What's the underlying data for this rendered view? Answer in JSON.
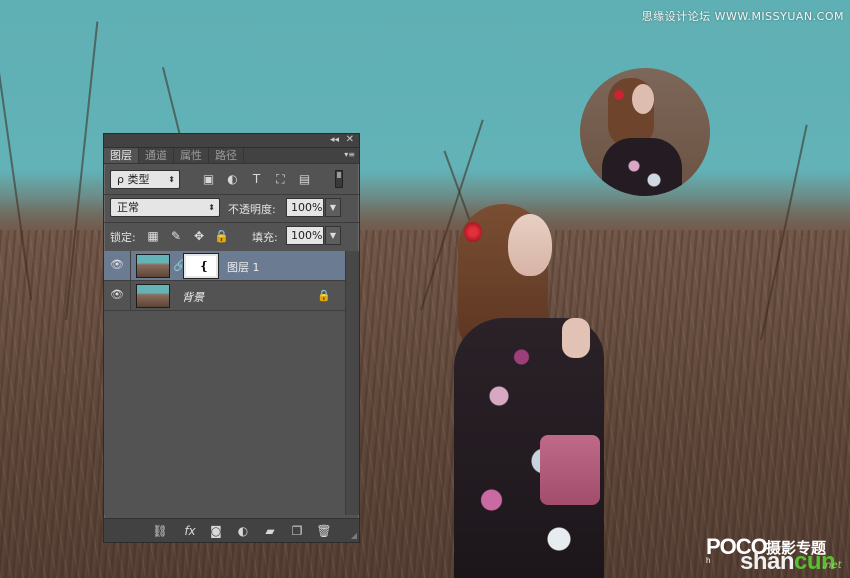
{
  "watermark": {
    "top_right": "思缘设计论坛 WWW.MISSYUAN.COM",
    "poco": "POCO",
    "poco_sub": "h",
    "topic": "摄影专题",
    "shancun_a": "shan",
    "shancun_b": "cun",
    "net": ".net"
  },
  "panel": {
    "collapse_label": "◂◂",
    "close_label": "✕",
    "tabs": [
      {
        "label": "图层",
        "active": true
      },
      {
        "label": "通道",
        "active": false
      },
      {
        "label": "属性",
        "active": false
      },
      {
        "label": "路径",
        "active": false
      }
    ],
    "menu_label": "▾≡",
    "filter": {
      "kind_label": "ρ 类型",
      "icons": [
        "image-filter-icon",
        "adjustment-filter-icon",
        "type-filter-icon",
        "shape-filter-icon",
        "smart-object-filter-icon"
      ],
      "icon_glyphs": [
        "▣",
        "◐",
        "T",
        "⛶",
        "▤"
      ]
    },
    "blend_mode": "正常",
    "opacity_label": "不透明度:",
    "opacity_value": "100%",
    "lock_label": "锁定:",
    "lock_glyphs": [
      "▦",
      "✎",
      "✥",
      "🔒"
    ],
    "fill_label": "填充:",
    "fill_value": "100%",
    "layers": [
      {
        "name": "图层 1",
        "selected": true,
        "has_mask": true,
        "mask_mark": "❴"
      },
      {
        "name": "背景",
        "selected": false,
        "locked": true
      }
    ],
    "eye_glyph": "👁",
    "link_glyph": "🔗",
    "lock_glyph": "🔒",
    "bottom_icons": [
      "link-layers-icon",
      "fx-icon",
      "add-mask-icon",
      "adjustment-layer-icon",
      "new-group-icon",
      "new-layer-icon",
      "delete-layer-icon"
    ],
    "bottom_glyphs": [
      "⛓",
      "fx",
      "◙",
      "◐",
      "▰",
      "❐",
      "🗑"
    ]
  }
}
